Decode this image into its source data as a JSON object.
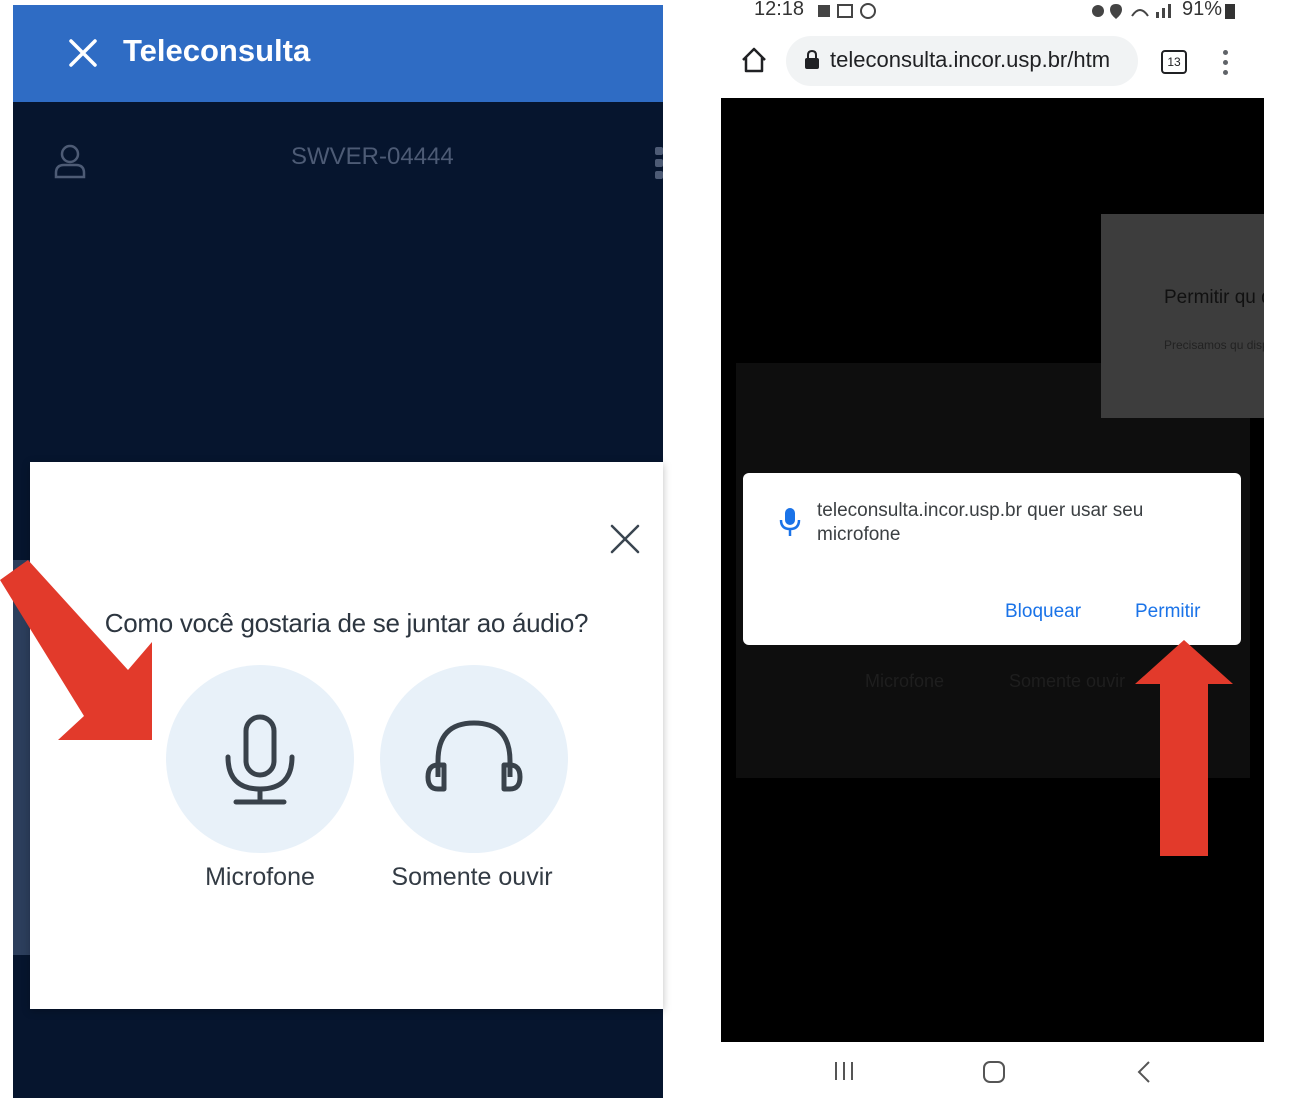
{
  "left_app": {
    "title": "Teleconsulta",
    "meeting_id": "SWVER-04444",
    "colors": {
      "header": "#2f6cc4",
      "background": "#06152e",
      "arrow": "#e23a2b"
    },
    "modal": {
      "question": "Como você gostaria de se juntar ao áudio?",
      "options": [
        {
          "label": "Microfone",
          "icon": "microphone-icon"
        },
        {
          "label": "Somente ouvir",
          "icon": "headphones-icon"
        }
      ]
    }
  },
  "phone": {
    "status_bar": {
      "time": "12:18",
      "battery": "91%"
    },
    "browser": {
      "url": "teleconsulta.incor.usp.br/htm",
      "tab_count": "13"
    },
    "background_dialog": {
      "title": "Permitir qu dispositivos",
      "subtitle": "Precisamos qu dispositivos de"
    },
    "background_labels": {
      "mic": "Microfone",
      "listen": "Somente ouvir"
    },
    "permission_prompt": {
      "message": "teleconsulta.incor.usp.br quer usar seu microfone",
      "block_label": "Bloquear",
      "allow_label": "Permitir"
    }
  }
}
